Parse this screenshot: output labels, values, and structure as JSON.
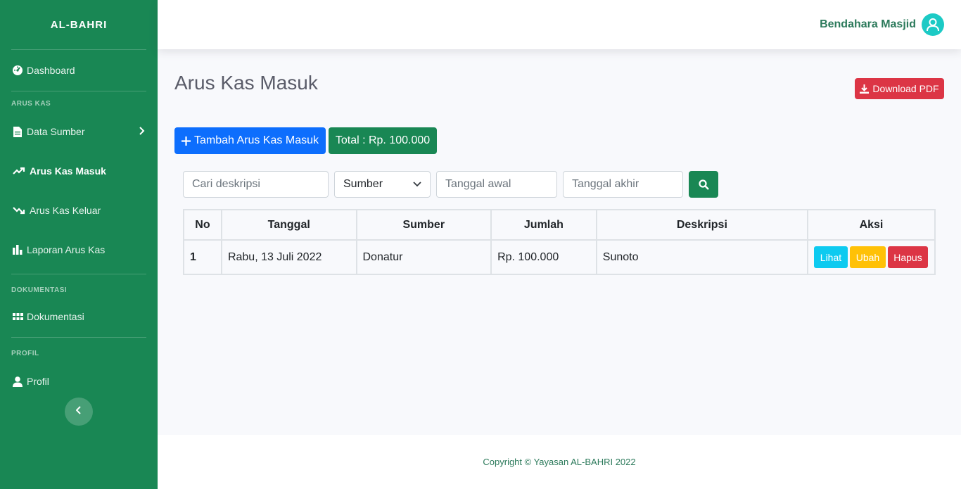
{
  "brand": "AL-BAHRI",
  "sidebar": {
    "dashboard": "Dashboard",
    "heading_arus_kas": "ARUS KAS",
    "data_sumber": "Data Sumber",
    "arus_kas_masuk": "Arus Kas Masuk",
    "arus_kas_keluar": "Arus Kas Keluar",
    "laporan_arus_kas": "Laporan Arus Kas",
    "heading_dokumentasi": "DOKUMENTASI",
    "dokumentasi": "Dokumentasi",
    "heading_profil": "PROFIL",
    "profil": "Profil"
  },
  "topbar": {
    "user_name": "Bendahara Masjid"
  },
  "page": {
    "title": "Arus Kas Masuk",
    "download_pdf": "Download PDF",
    "add_button": "Tambah Arus Kas Masuk",
    "total": "Total : Rp. 100.000"
  },
  "filters": {
    "search_placeholder": "Cari deskripsi",
    "source_selected": "Sumber",
    "start_date_placeholder": "Tanggal awal",
    "end_date_placeholder": "Tanggal akhir"
  },
  "table": {
    "headers": [
      "No",
      "Tanggal",
      "Sumber",
      "Jumlah",
      "Deskripsi",
      "Aksi"
    ],
    "rows": [
      {
        "no": "1",
        "tanggal": "Rabu, 13 Juli 2022",
        "sumber": "Donatur",
        "jumlah": "Rp. 100.000",
        "deskripsi": "Sunoto"
      }
    ],
    "actions": {
      "view": "Lihat",
      "edit": "Ubah",
      "delete": "Hapus"
    }
  },
  "footer": "Copyright © Yayasan AL-BAHRI 2022",
  "colors": {
    "sidebar": "#198754",
    "primary": "#0d6efd",
    "danger": "#dc3545",
    "info": "#0dcaf0",
    "warning": "#ffc107",
    "avatar": "#1ccac5"
  }
}
